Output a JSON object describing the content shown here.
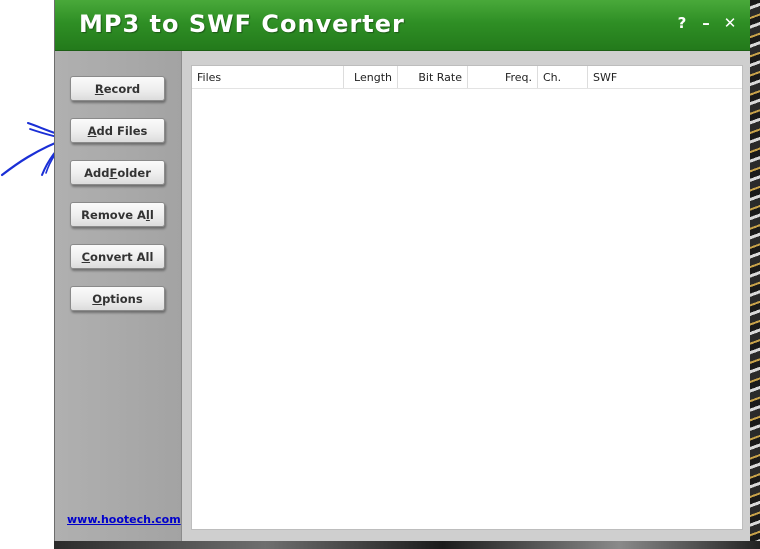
{
  "window": {
    "title": "MP3 to SWF Converter",
    "controls": {
      "help": "?",
      "minimize": "–",
      "close": "✕"
    },
    "title_bar_color": "#2f8f25"
  },
  "sidebar": {
    "buttons": [
      {
        "label": "Record",
        "mnemonic": "R",
        "rest": "ecord"
      },
      {
        "label": "Add Files",
        "mnemonic": "A",
        "rest": "dd Files"
      },
      {
        "label": "Add Folder",
        "pre": "Add ",
        "mnemonic": "F",
        "rest": "older"
      },
      {
        "label": "Remove All",
        "pre": "Remove A",
        "mnemonic": "l",
        "rest": "l"
      },
      {
        "label": "Convert All",
        "mnemonic": "C",
        "rest": "onvert All"
      },
      {
        "label": "Options",
        "mnemonic": "O",
        "rest": "ptions"
      }
    ],
    "link": "www.hootech.com"
  },
  "file_list": {
    "columns": [
      "Files",
      "Length",
      "Bit Rate",
      "Freq.",
      "Ch.",
      "SWF"
    ],
    "rows": []
  },
  "annotation": {
    "color": "#1a2fd6"
  }
}
